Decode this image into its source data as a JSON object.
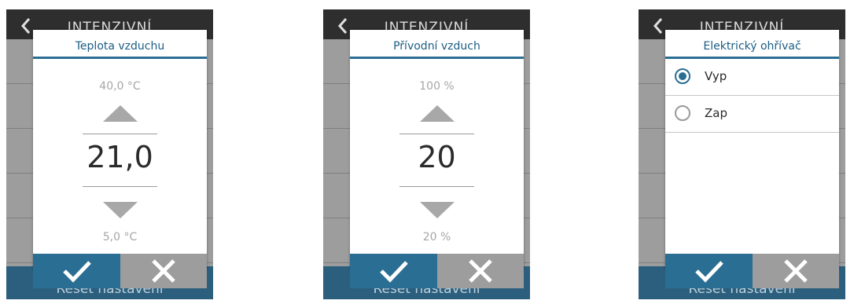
{
  "colors": {
    "accent": "#2a6e93",
    "header_bg": "#2e2e2e",
    "screen_bg": "#9d9d9d",
    "bottom_bar": "#2c5f7e"
  },
  "screens": [
    {
      "header_title": "INTENZIVNÍ",
      "bottom_label": "Reset nastavení",
      "dialog": {
        "title": "Teplota vzduchu",
        "max": "40,0 °C",
        "value": "21,0",
        "min": "5,0 °C",
        "ok_icon": "check-icon",
        "cancel_icon": "close-icon"
      }
    },
    {
      "header_title": "INTENZIVNÍ",
      "bottom_label": "Reset nastavení",
      "dialog": {
        "title": "Přívodní vzduch",
        "max": "100 %",
        "value": "20",
        "min": "20 %",
        "ok_icon": "check-icon",
        "cancel_icon": "close-icon"
      }
    },
    {
      "header_title": "INTENZIVNÍ",
      "bottom_label": "Reset nastavení",
      "dialog": {
        "title": "Elektrický ohřívač",
        "options": [
          {
            "label": "Vyp",
            "selected": true
          },
          {
            "label": "Zap",
            "selected": false
          }
        ],
        "ok_icon": "check-icon",
        "cancel_icon": "close-icon"
      }
    }
  ]
}
